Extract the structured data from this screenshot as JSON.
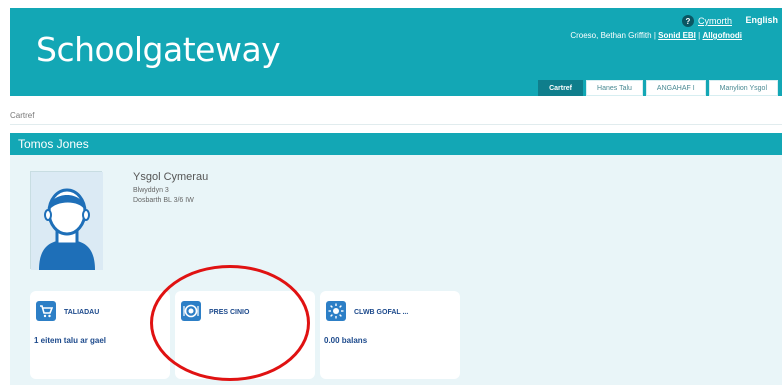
{
  "header": {
    "logo_text": "Schoolgateway",
    "help_link": "Cymorth",
    "language_link": "English",
    "user_name": "Croeso, Bethan Griffith",
    "user_links": [
      "Sonid EBI",
      "Allgofnodi"
    ],
    "tabs": [
      {
        "label": "Cartref",
        "active": true
      },
      {
        "label": "Hanes Talu",
        "active": false
      },
      {
        "label": "ANGAHAF I",
        "active": false
      },
      {
        "label": "Manylion Ysgol",
        "active": false
      }
    ]
  },
  "breadcrumb": "Cartref",
  "student": {
    "name": "Tomos Jones",
    "school": "Ysgol Cymerau",
    "year": "Blwyddyn 3",
    "class": "Dosbarth BL 3/6 IW"
  },
  "cards": [
    {
      "title": "TALIADAU",
      "subtitle": "1 eitem talu ar gael",
      "icon": "cart-icon"
    },
    {
      "title": "PRES CINIO",
      "subtitle": "",
      "icon": "lunch-plate-icon"
    },
    {
      "title": "CLWB GOFAL ...",
      "subtitle": "0.00 balans",
      "icon": "sun-icon"
    }
  ],
  "colors": {
    "brand": "#13a7b5",
    "tab_active": "#0f7e8c",
    "card_title": "#1d4a8c",
    "icon_bg": "#2d7fc6",
    "annotation_circle": "#e01212"
  }
}
